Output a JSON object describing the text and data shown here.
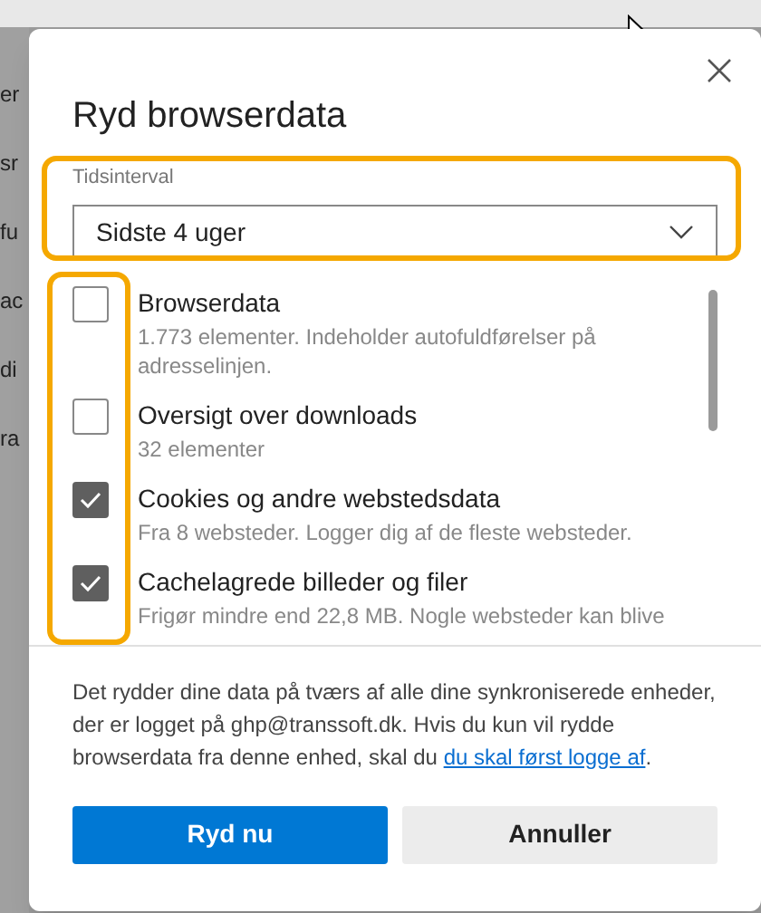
{
  "background_fragments": [
    "er",
    "sr",
    "fu",
    "ac",
    "di",
    "ra"
  ],
  "dialog": {
    "title": "Ryd browserdata",
    "time_range": {
      "label": "Tidsinterval",
      "value": "Sidste 4 uger"
    },
    "items": [
      {
        "label": "Browserdata",
        "description": "1.773 elementer. Indeholder autofuldførelser på adresselinjen.",
        "checked": false
      },
      {
        "label": "Oversigt over downloads",
        "description": "32 elementer",
        "checked": false
      },
      {
        "label": "Cookies og andre webstedsdata",
        "description": "Fra 8 websteder. Logger dig af de fleste websteder.",
        "checked": true
      },
      {
        "label": "Cachelagrede billeder og filer",
        "description": "Frigør mindre end 22,8 MB. Nogle websteder kan blive",
        "checked": true
      }
    ],
    "notice": "Det rydder dine data på tværs af alle dine synkroniserede enheder, der er logget på ghp@transsoft.dk. Hvis du kun vil rydde browserdata fra denne enhed, skal du",
    "notice_link": "du skal først logge af",
    "notice_end": ".",
    "buttons": [
      {
        "label": "Ryd nu",
        "kind": "primary"
      },
      {
        "label": "Annuller",
        "kind": "secondary"
      }
    ]
  }
}
